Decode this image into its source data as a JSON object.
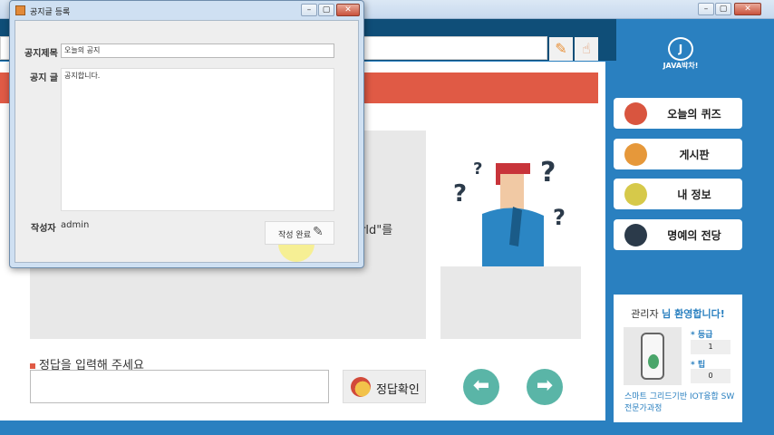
{
  "main": {
    "window_controls": {
      "minimize": "–",
      "maximize": "▢",
      "close": "✕"
    },
    "question_fragment": "rld\"를",
    "answer_label": "정답을 입력해 주세요",
    "check_button": "정답확인",
    "prev_arrow": "⬅",
    "next_arrow": "➡",
    "logo_text": "JAVA박차!",
    "logo_mark": "J"
  },
  "menu": {
    "items": [
      {
        "label": "오늘의 퀴즈",
        "icon": "quiz-icon"
      },
      {
        "label": "게시판",
        "icon": "board-icon"
      },
      {
        "label": "내 정보",
        "icon": "profile-icon"
      },
      {
        "label": "명예의 전당",
        "icon": "trophy-icon"
      }
    ]
  },
  "profile": {
    "name": "관리자",
    "welcome": "님 환영합니다!",
    "grade_label": "* 등급",
    "grade_value": "1",
    "tip_label": "* 팁",
    "tip_value": "0",
    "course": "스마트 그리드기반 IOT융합 SW 전문가과정"
  },
  "dialog": {
    "title": "공지글 등록",
    "title_label": "공지제목",
    "title_value": "오늘의 공지",
    "body_label": "공지 글",
    "body_value": "공지합니다.",
    "author_label": "작성자",
    "author_value": "admin",
    "submit_label": "작성 완료",
    "submit_icon": "✎"
  },
  "colors": {
    "accent_blue": "#2a80c0",
    "header_red": "#e05a45",
    "nav_teal": "#5ab5a7"
  }
}
